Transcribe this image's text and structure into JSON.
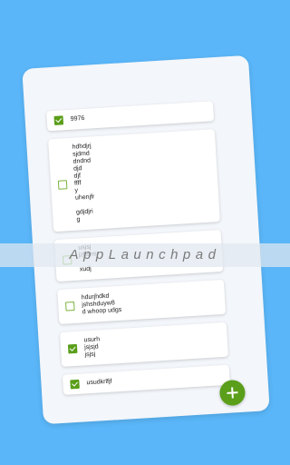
{
  "banner": {
    "text": "AppLaunchpad"
  },
  "items": [
    {
      "text": "9976",
      "checked": true
    },
    {
      "text": "hdhdjrj\nsjdmd\ndndnd\ndjd\ndjf\nffff\ny\nuhenjfr\n\ngdjdjri\ng",
      "checked": false
    },
    {
      "text": "usjsj\njzhsns\n\nxudj",
      "checked": false
    },
    {
      "text": "hdurjhdkd\njshshduyw8\nd whoop udgs",
      "checked": false
    },
    {
      "text": "usurh\njsjsjd\njsjsj",
      "checked": true
    },
    {
      "text": "usudkrlfjf",
      "checked": true
    }
  ],
  "fab": {
    "icon": "plus-icon"
  },
  "colors": {
    "background": "#5ab6f8",
    "accent": "#5a9e1a"
  }
}
